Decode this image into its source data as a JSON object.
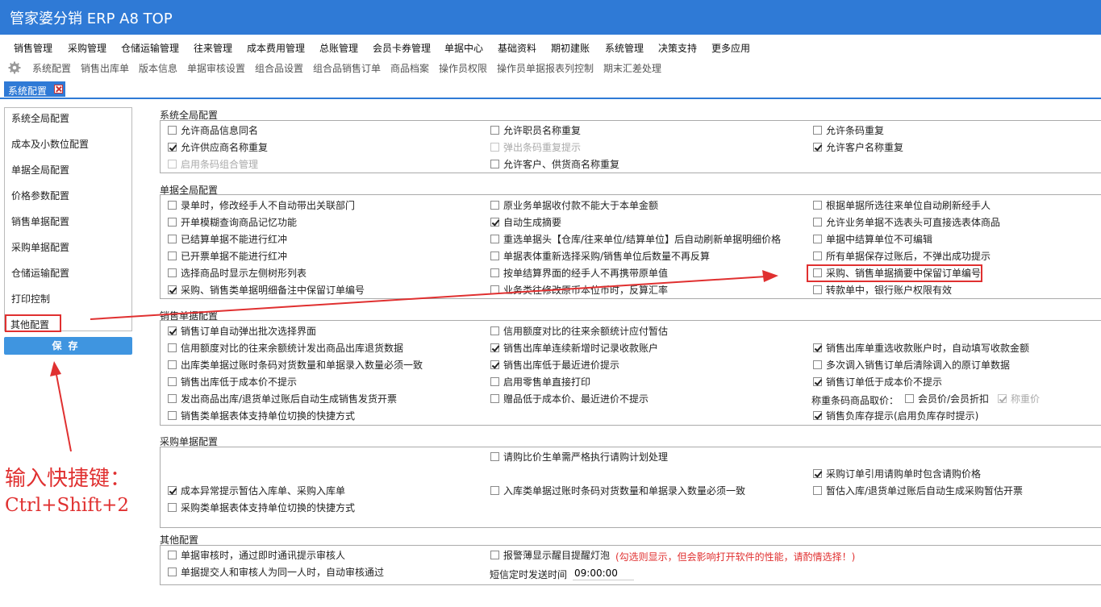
{
  "app": {
    "title": "管家婆分销 ERP A8 TOP"
  },
  "menu": [
    "销售管理",
    "采购管理",
    "仓储运输管理",
    "往来管理",
    "成本费用管理",
    "总账管理",
    "会员卡券管理",
    "单据中心",
    "基础资料",
    "期初建账",
    "系统管理",
    "决策支持",
    "更多应用"
  ],
  "toolbar": [
    "系统配置",
    "销售出库单",
    "版本信息",
    "单据审核设置",
    "组合品设置",
    "组合品销售订单",
    "商品档案",
    "操作员权限",
    "操作员单据报表列控制",
    "期末汇差处理"
  ],
  "tab": {
    "label": "系统配置"
  },
  "sidebar": {
    "items": [
      "系统全局配置",
      "成本及小数位配置",
      "单据全局配置",
      "价格参数配置",
      "销售单据配置",
      "采购单据配置",
      "仓储运输配置",
      "打印控制",
      "其他配置"
    ],
    "save_label": "保存"
  },
  "annotation": {
    "line1": "输入快捷键：",
    "line2": "Ctrl+Shift+2"
  },
  "sections": {
    "global": {
      "title": "系统全局配置",
      "items": [
        {
          "label": "允许商品信息同名",
          "checked": false,
          "disabled": false
        },
        {
          "label": "允许职员名称重复",
          "checked": false,
          "disabled": false
        },
        {
          "label": "允许条码重复",
          "checked": false,
          "disabled": false
        },
        {
          "label": "允许供应商名称重复",
          "checked": true,
          "disabled": false
        },
        {
          "label": "弹出条码重复提示",
          "checked": false,
          "disabled": true
        },
        {
          "label": "允许客户名称重复",
          "checked": true,
          "disabled": false
        },
        {
          "label": "启用条码组合管理",
          "checked": false,
          "disabled": true
        },
        {
          "label": "允许客户、供货商名称重复",
          "checked": false,
          "disabled": false
        }
      ]
    },
    "bill": {
      "title": "单据全局配置",
      "items": [
        {
          "label": "录单时，修改经手人不自动带出关联部门",
          "checked": false
        },
        {
          "label": "原业务单据收付款不能大于本单金额",
          "checked": false
        },
        {
          "label": "根据单据所选往来单位自动刷新经手人",
          "checked": false
        },
        {
          "label": "开单模糊查询商品记忆功能",
          "checked": false
        },
        {
          "label": "自动生成摘要",
          "checked": true
        },
        {
          "label": "允许业务单据不选表头可直接选表体商品",
          "checked": false
        },
        {
          "label": "已结算单据不能进行红冲",
          "checked": false
        },
        {
          "label": "重选单据头【仓库/往来单位/结算单位】后自动刷新单据明细价格",
          "checked": false
        },
        {
          "label": "单据中结算单位不可编辑",
          "checked": false
        },
        {
          "label": "已开票单据不能进行红冲",
          "checked": false
        },
        {
          "label": "单据表体重新选择采购/销售单位后数量不再反算",
          "checked": false
        },
        {
          "label": "所有单据保存过账后，不弹出成功提示",
          "checked": false
        },
        {
          "label": "选择商品时显示左侧树形列表",
          "checked": false
        },
        {
          "label": "按单结算界面的经手人不再携带原单值",
          "checked": false
        },
        {
          "label": "采购、销售单据摘要中保留订单编号",
          "checked": false
        },
        {
          "label": "采购、销售类单据明细备注中保留订单编号",
          "checked": true
        },
        {
          "label": "业务类往修改原币本位币时，反算汇率",
          "checked": false
        },
        {
          "label": "转款单中，银行账户权限有效",
          "checked": false
        }
      ]
    },
    "sales": {
      "title": "销售单据配置",
      "items": [
        {
          "label": "销售订单自动弹出批次选择界面",
          "checked": true
        },
        {
          "label": "信用额度对比的往来余额统计应付暂估",
          "checked": false
        },
        {
          "label": "信用额度对比的往来余额统计发出商品出库退货数据",
          "checked": false
        },
        {
          "label": "销售出库单连续新增时记录收款账户",
          "checked": true
        },
        {
          "label": "销售出库单重选收款账户时，自动填写收款金额",
          "checked": true
        },
        {
          "label": "出库类单据过账时条码对货数量和单据录入数量必须一致",
          "checked": false
        },
        {
          "label": "销售出库低于最近进价提示",
          "checked": true
        },
        {
          "label": "多次调入销售订单后清除调入的原订单数据",
          "checked": false
        },
        {
          "label": "销售出库低于成本价不提示",
          "checked": false
        },
        {
          "label": "启用零售单直接打印",
          "checked": false
        },
        {
          "label": "销售订单低于成本价不提示",
          "checked": true
        },
        {
          "label": "发出商品出库/退货单过账后自动生成销售发货开票",
          "checked": false
        },
        {
          "label": "赠品低于成本价、最近进价不提示",
          "checked": false
        },
        {
          "label": "销售类单据表体支持单位切换的快捷方式",
          "checked": false
        },
        {
          "label": "销售负库存提示(启用负库存时提示)",
          "checked": true
        }
      ],
      "weigh_label": "称重条码商品取价：",
      "weigh_opt1": {
        "label": "会员价/会员折扣",
        "checked": false
      },
      "weigh_opt2": {
        "label": "称重价",
        "checked": true,
        "disabled": true
      }
    },
    "purchase": {
      "title": "采购单据配置",
      "items": [
        {
          "label": "请购比价生单需严格执行请购计划处理",
          "checked": false
        },
        {
          "label": "采购订单引用请购单时包含请购价格",
          "checked": true
        },
        {
          "label": "成本异常提示暂估入库单、采购入库单",
          "checked": true
        },
        {
          "label": "入库类单据过账时条码对货数量和单据录入数量必须一致",
          "checked": false
        },
        {
          "label": "暂估入库/退货单过账后自动生成采购暂估开票",
          "checked": false
        },
        {
          "label": "采购类单据表体支持单位切换的快捷方式",
          "checked": false
        }
      ]
    },
    "other": {
      "title": "其他配置",
      "items": [
        {
          "label": "单据审核时，通过即时通讯提示审核人",
          "checked": false
        },
        {
          "label": "报警薄显示醒目提醒灯泡",
          "checked": false
        },
        {
          "label": "单据提交人和审核人为同一人时，自动审核通过",
          "checked": false
        }
      ],
      "alarm_note": "(勾选则显示，但会影响打开软件的性能，请酌情选择！)",
      "sms_label": "短信定时发送时间",
      "sms_time": "09:00:00"
    }
  },
  "colors": {
    "title_bar": "#2f7ad6",
    "accent_red": "#e03030",
    "save_button": "#3f95e0"
  }
}
